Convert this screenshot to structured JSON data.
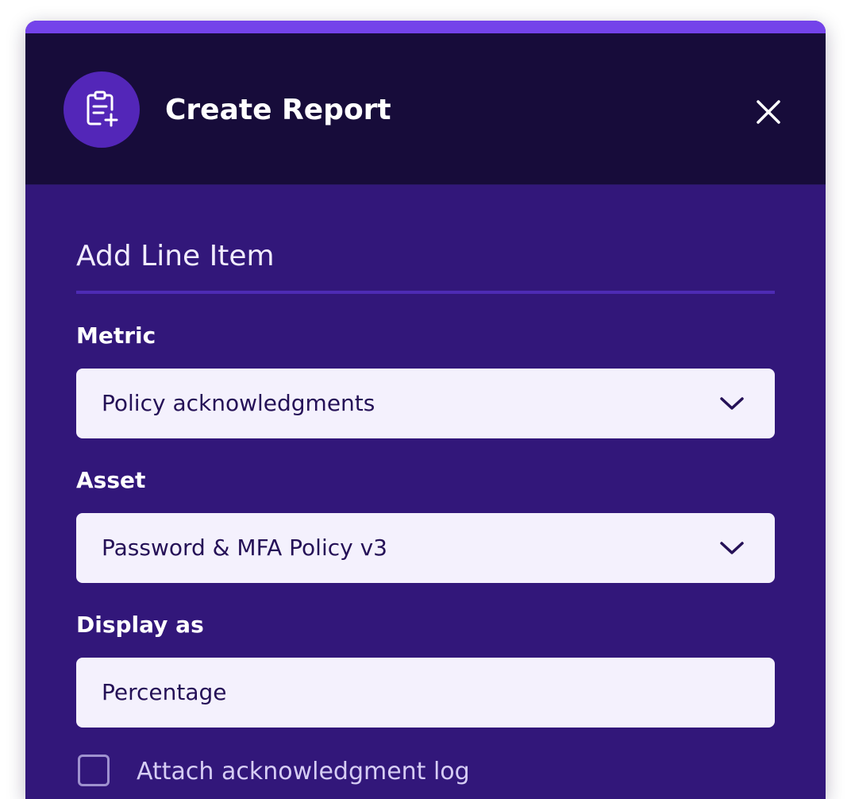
{
  "dialog": {
    "title": "Create Report",
    "header_icon": "clipboard-plus-icon",
    "close_icon": "close-icon",
    "colors": {
      "accent": "#7443ea",
      "header_bg": "#170c3a",
      "body_bg": "#32177a",
      "field_bg": "#f4f1fd"
    }
  },
  "section": {
    "title": "Add Line Item"
  },
  "fields": {
    "metric": {
      "label": "Metric",
      "value": "Policy acknowledgments"
    },
    "asset": {
      "label": "Asset",
      "value": "Password & MFA Policy v3"
    },
    "display_as": {
      "label": "Display as",
      "value": "Percentage"
    }
  },
  "options": {
    "attach_log": {
      "label": "Attach acknowledgment log",
      "checked": false
    }
  }
}
